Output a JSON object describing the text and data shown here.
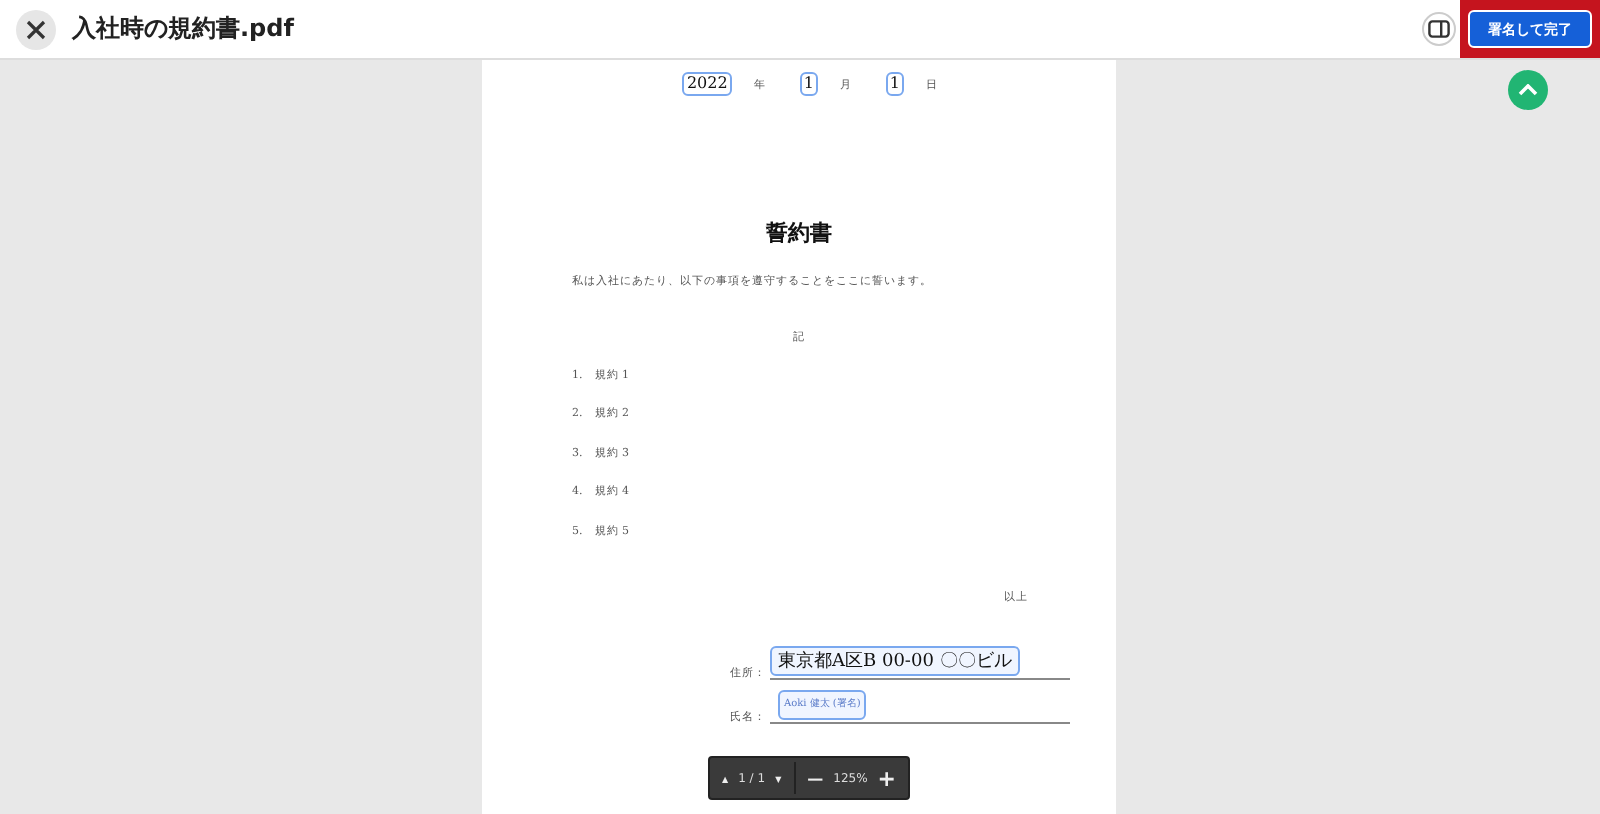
{
  "window": {
    "title": "入社時の規約書.pdf"
  },
  "header_buttons": {
    "finish": "署名して完了",
    "finish_highlighted": true
  },
  "document": {
    "date": [
      {
        "kind": "field",
        "value": "2022"
      },
      {
        "kind": "label",
        "text": "年"
      },
      {
        "kind": "field",
        "value": "1"
      },
      {
        "kind": "label",
        "text": "月"
      },
      {
        "kind": "field",
        "value": "1"
      },
      {
        "kind": "label",
        "text": "日"
      }
    ],
    "title": "誓約書",
    "intro": "私は入社にあたり、以下の事項を遵守することをここに誓います。",
    "note": "記",
    "items": [
      {
        "number": "1.",
        "text": "規約 1"
      },
      {
        "number": "2.",
        "text": "規約 2"
      },
      {
        "number": "3.",
        "text": "規約 3"
      },
      {
        "number": "4.",
        "text": "規約 4"
      },
      {
        "number": "5.",
        "text": "規約 5"
      }
    ],
    "closing": "以上",
    "address": {
      "label": "住所：",
      "value": "東京都A区B 00-00 〇〇ビル"
    },
    "name": {
      "label": "氏名：",
      "value": "Aoki 健太 (署名)"
    }
  },
  "pager": {
    "prev": "▲",
    "page": "1 / 1",
    "next": "▼",
    "zoom_out": "—",
    "zoom": "125%",
    "zoom_in": "+"
  }
}
